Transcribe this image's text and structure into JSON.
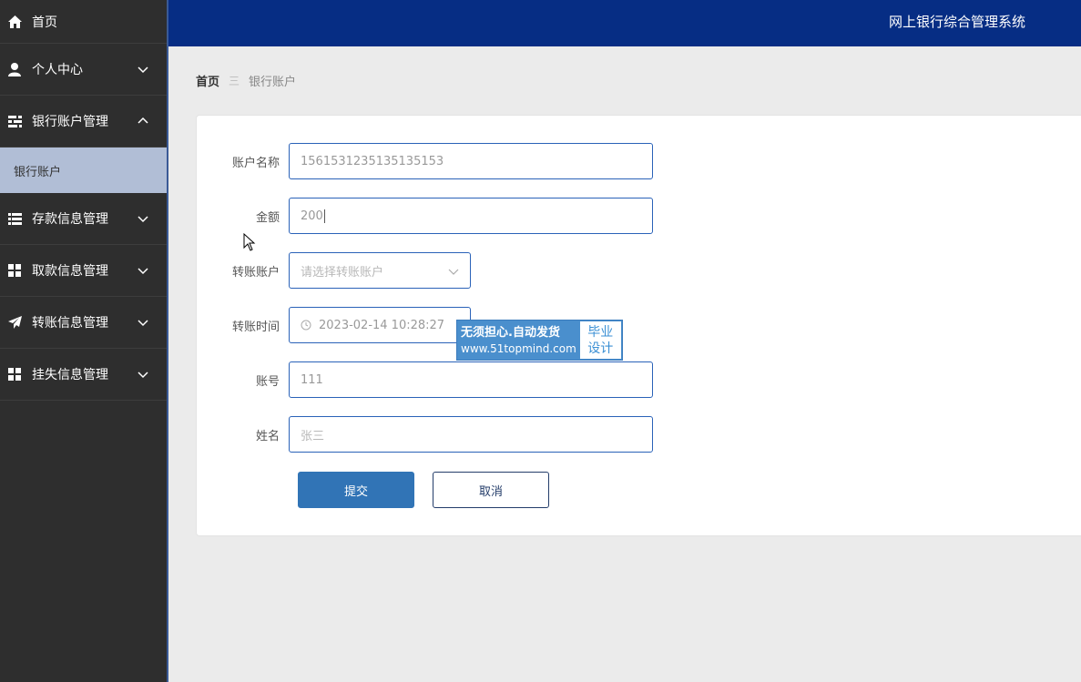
{
  "sidebar": {
    "items": [
      {
        "label": "首页"
      },
      {
        "label": "个人中心"
      },
      {
        "label": "银行账户管理"
      },
      {
        "label": "存款信息管理"
      },
      {
        "label": "取款信息管理"
      },
      {
        "label": "转账信息管理"
      },
      {
        "label": "挂失信息管理"
      }
    ],
    "sub_item": "银行账户"
  },
  "header": {
    "title": "网上银行综合管理系统"
  },
  "breadcrumb": {
    "home": "首页",
    "separator": "三",
    "current": "银行账户"
  },
  "form": {
    "account_name": {
      "label": "账户名称",
      "value": "1561531235135135153"
    },
    "amount": {
      "label": "金额",
      "value": "200"
    },
    "transfer_account": {
      "label": "转账账户",
      "placeholder": "请选择转账账户"
    },
    "transfer_time": {
      "label": "转账时间",
      "value": "2023-02-14 10:28:27"
    },
    "account_no": {
      "label": "账号",
      "value": "111"
    },
    "name": {
      "label": "姓名",
      "placeholder": "张三"
    },
    "submit_label": "提交",
    "cancel_label": "取消"
  },
  "watermark": {
    "line1": "无须担心.自动发货",
    "line2": "www.51topmind.com",
    "badge1": "毕业",
    "badge2": "设计"
  },
  "colors": {
    "sidebar_bg": "#2e2e2e",
    "header_bg": "#062d84",
    "primary": "#3174b6",
    "active_sub_bg": "#b1bed6"
  }
}
